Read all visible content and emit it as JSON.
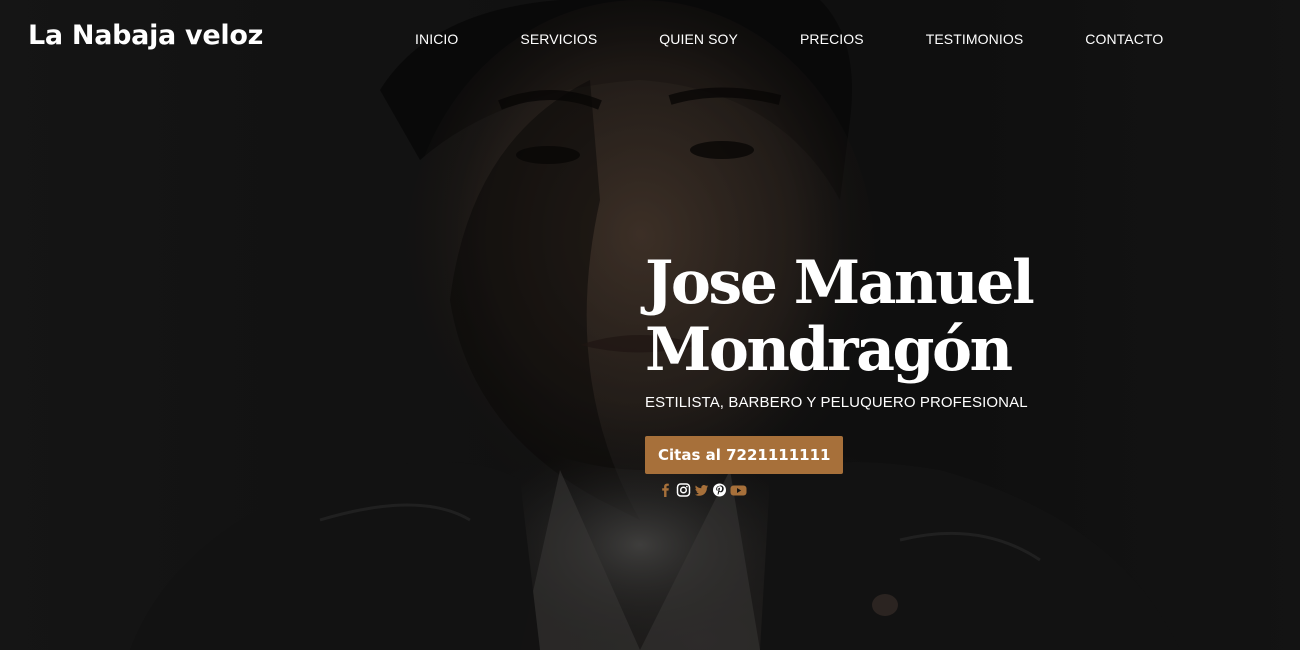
{
  "header": {
    "logo": "La Nabaja veloz",
    "nav": [
      "INICIO",
      "SERVICIOS",
      "QUIEN SOY",
      "PRECIOS",
      "TESTIMONIOS",
      "CONTACTO"
    ]
  },
  "hero": {
    "name_line1": "Jose Manuel",
    "name_line2": "Mondragón",
    "subtitle": "ESTILISTA, BARBERO Y PELUQUERO PROFESIONAL",
    "cta_label": "Citas al 7221111111"
  },
  "social": {
    "icons": [
      "facebook-icon",
      "instagram-icon",
      "twitter-icon",
      "pinterest-icon",
      "youtube-icon"
    ]
  },
  "colors": {
    "accent": "#a7703a",
    "background": "#141414",
    "text": "#ffffff"
  }
}
